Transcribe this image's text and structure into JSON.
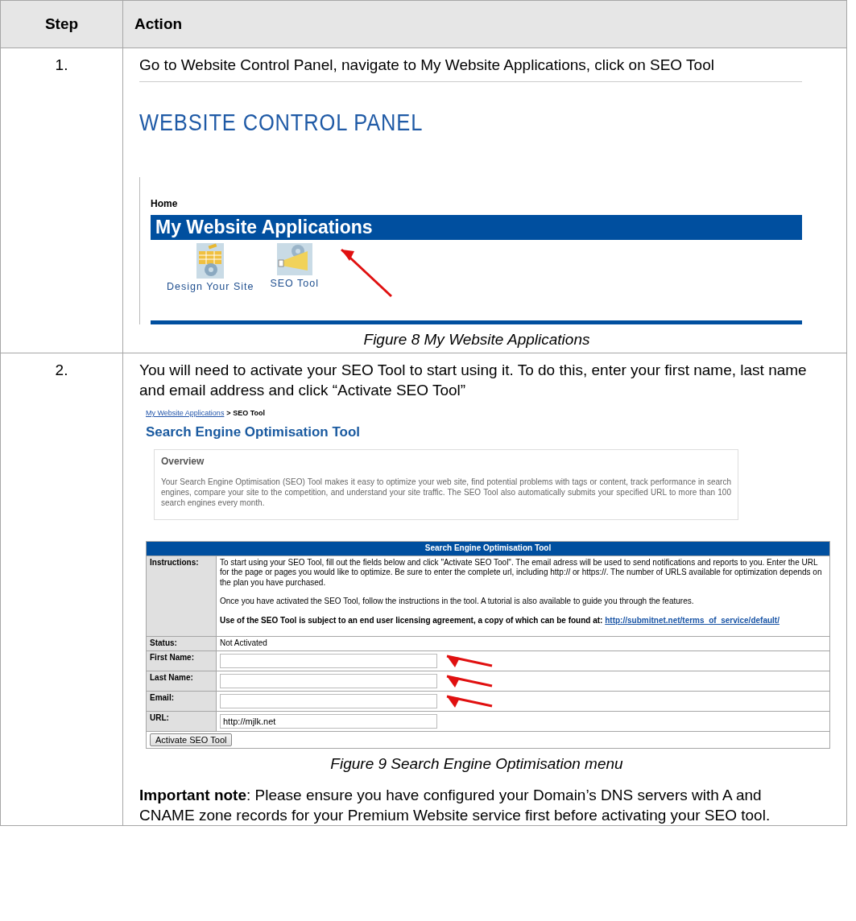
{
  "table": {
    "columns": [
      "Step",
      "Action"
    ]
  },
  "steps": [
    {
      "number": "1.",
      "text": "Go to Website Control Panel, navigate to My Website Applications, click on SEO Tool",
      "figure": {
        "kind": "control_panel",
        "title": "WEBSITE CONTROL PANEL",
        "breadcrumb": "Home",
        "section": "My Website Applications",
        "apps": [
          {
            "label": "Design Your Site"
          },
          {
            "label": "SEO Tool"
          }
        ]
      },
      "caption": "Figure 8 My Website Applications"
    },
    {
      "number": "2.",
      "text": "You will need to activate your SEO Tool to start using it. To do this, enter your first name, last name and email address and click “Activate SEO Tool”",
      "figure": {
        "kind": "seo_tool",
        "breadcrumb_link": "My Website Applications",
        "breadcrumb_separator": ">",
        "breadcrumb_current": "SEO Tool",
        "title": "Search Engine Optimisation Tool",
        "overview_heading": "Overview",
        "overview_text": "Your Search Engine Optimisation (SEO) Tool makes it easy to optimize your web site, find potential problems with tags or content, track performance in search engines, compare your site to the competition, and understand your site traffic. The SEO Tool also automatically submits your specified URL to more than 100 search engines every month.",
        "form_title": "Search Engine Optimisation Tool",
        "instructions_label": "Instructions:",
        "instructions": [
          "To start using your SEO Tool, fill out the fields below and click \"Activate SEO Tool\". The email adress will be used to send notifications and reports to you. Enter the URL for the page or pages you would like to optimize. Be sure to enter the complete url, including http:// or https://. The number of URLS available for optimization depends on the plan you have purchased.",
          "Once you have activated the SEO Tool, follow the instructions in the tool. A tutorial is also available to guide you through the features."
        ],
        "license_text": "Use of the SEO Tool is subject to an end user licensing agreement, a copy of which can be found at:",
        "license_link": "http://submitnet.net/terms_of_service/default/",
        "status_label": "Status:",
        "status_value": "Not Activated",
        "fields": [
          {
            "label": "First Name:",
            "highlighted": true
          },
          {
            "label": "Last Name:",
            "highlighted": true
          },
          {
            "label": "Email:",
            "highlighted": true
          },
          {
            "label": "URL:",
            "value": "http://mjlk.net",
            "highlighted": false
          }
        ],
        "button": "Activate SEO Tool"
      },
      "caption": "Figure 9 Search Engine Optimisation menu",
      "note": "**Important note**: Please ensure you have configured your Domain’s DNS servers with A and CNAME zone records for your Premium Website service first before activating your SEO tool."
    }
  ]
}
